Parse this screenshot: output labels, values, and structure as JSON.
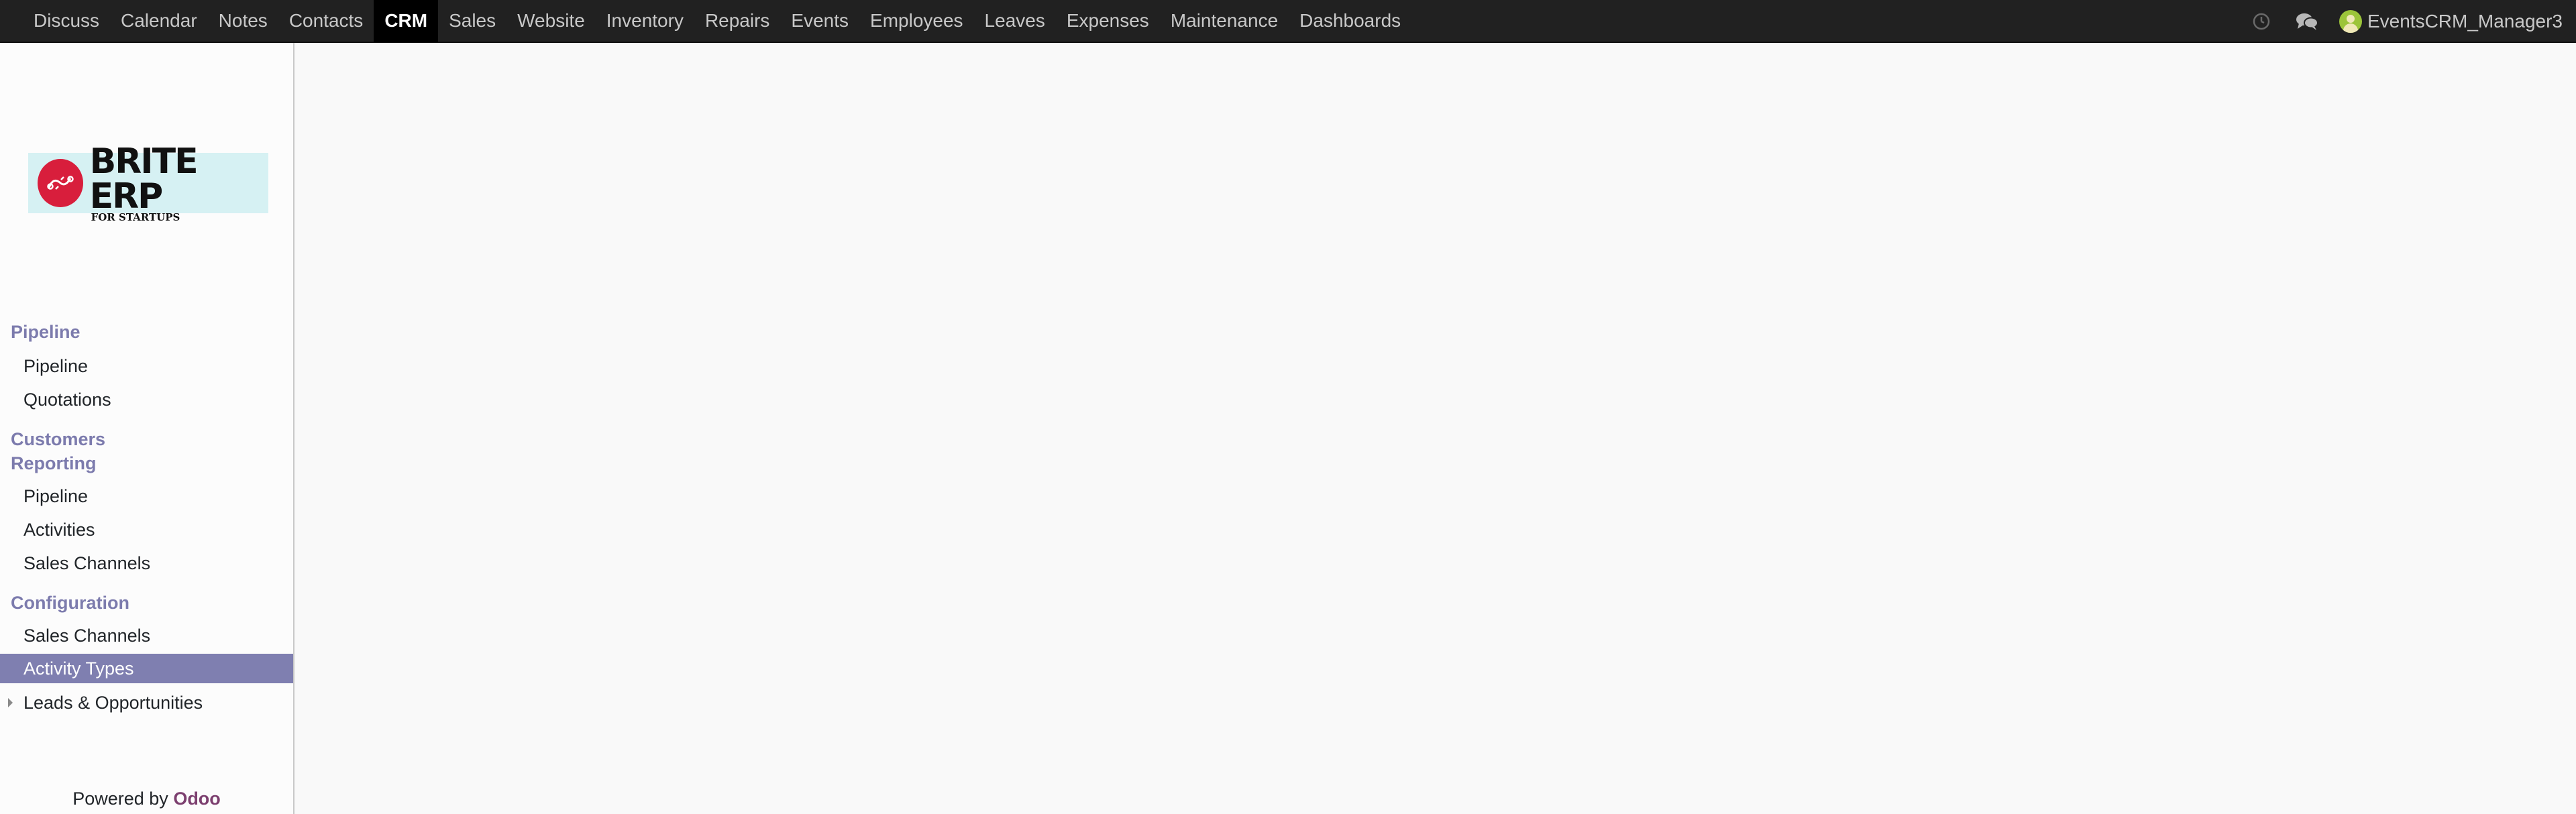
{
  "topbar": {
    "apps": [
      "Discuss",
      "Calendar",
      "Notes",
      "Contacts",
      "CRM",
      "Sales",
      "Website",
      "Inventory",
      "Repairs",
      "Events",
      "Employees",
      "Leaves",
      "Expenses",
      "Maintenance",
      "Dashboards"
    ],
    "active_app": "CRM",
    "icons": [
      "clock-icon",
      "chat-bubbles-icon"
    ],
    "user": "EventsCRM_Manager3"
  },
  "logo": {
    "main": "BRITE ERP",
    "sub": "FOR STARTUPS"
  },
  "sidebar": {
    "pipeline_head": "Pipeline",
    "pipeline_items": [
      "Pipeline",
      "Quotations"
    ],
    "customers_head": "Customers",
    "reporting_head": "Reporting",
    "reporting_items": [
      "Pipeline",
      "Activities",
      "Sales Channels"
    ],
    "configuration_head": "Configuration",
    "configuration_items": [
      "Sales Channels",
      "Activity Types",
      "Leads & Opportunities"
    ],
    "active_item": "Activity Types"
  },
  "footer": {
    "powered_by": "Powered by",
    "brand": "Odoo"
  },
  "colors": {
    "topbar_bg": "#212121",
    "section_head": "#7c7bad",
    "active_item_bg": "#7f7fb0",
    "odoo_brand": "#7c3f6f"
  }
}
